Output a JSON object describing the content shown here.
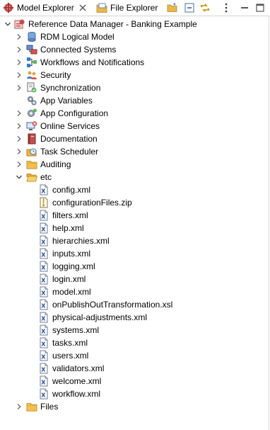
{
  "tabs": [
    {
      "label": "Model Explorer",
      "active": true,
      "icon": "model-explorer-icon"
    },
    {
      "label": "File Explorer",
      "active": false,
      "icon": "file-explorer-icon"
    }
  ],
  "toolbar": [
    "open-folder-icon",
    "collapse-all-icon",
    "link-editor-icon",
    "view-menu-icon"
  ],
  "tree": {
    "root": {
      "label": "Reference Data Manager - Banking Example",
      "expanded": true
    },
    "items": [
      {
        "label": "RDM Logical Model",
        "icon": "database-icon",
        "expanded": false
      },
      {
        "label": "Connected Systems",
        "icon": "connected-systems-icon",
        "expanded": false
      },
      {
        "label": "Workflows and Notifications",
        "icon": "workflow-icon",
        "expanded": false
      },
      {
        "label": "Security",
        "icon": "users-icon",
        "expanded": false
      },
      {
        "label": "Synchronization",
        "icon": "sync-icon",
        "expanded": false
      },
      {
        "label": "App Variables",
        "icon": "gears-icon",
        "expanded": null
      },
      {
        "label": "App Configuration",
        "icon": "gear-icon",
        "expanded": false
      },
      {
        "label": "Online Services",
        "icon": "online-services-icon",
        "expanded": false
      },
      {
        "label": "Documentation",
        "icon": "book-icon",
        "expanded": false
      },
      {
        "label": "Task Scheduler",
        "icon": "clock-icon",
        "expanded": false
      },
      {
        "label": "Auditing",
        "icon": "folder-closed-icon",
        "expanded": false
      },
      {
        "label": "etc",
        "icon": "folder-open-icon",
        "expanded": true
      }
    ],
    "files": [
      {
        "label": "config.xml",
        "icon": "xml-file-icon"
      },
      {
        "label": "configurationFiles.zip",
        "icon": "zip-file-icon"
      },
      {
        "label": "filters.xml",
        "icon": "xml-file-icon"
      },
      {
        "label": "help.xml",
        "icon": "xml-file-icon"
      },
      {
        "label": "hierarchies.xml",
        "icon": "xml-file-icon"
      },
      {
        "label": "inputs.xml",
        "icon": "xml-file-icon"
      },
      {
        "label": "logging.xml",
        "icon": "xml-file-icon"
      },
      {
        "label": "login.xml",
        "icon": "xml-file-icon"
      },
      {
        "label": "model.xml",
        "icon": "xml-file-icon"
      },
      {
        "label": "onPublishOutTransformation.xsl",
        "icon": "xml-file-icon"
      },
      {
        "label": "physical-adjustments.xml",
        "icon": "xml-file-icon"
      },
      {
        "label": "systems.xml",
        "icon": "xml-file-icon"
      },
      {
        "label": "tasks.xml",
        "icon": "xml-file-icon"
      },
      {
        "label": "users.xml",
        "icon": "xml-file-icon"
      },
      {
        "label": "validators.xml",
        "icon": "xml-file-icon"
      },
      {
        "label": "welcome.xml",
        "icon": "xml-file-icon"
      },
      {
        "label": "workflow.xml",
        "icon": "xml-file-icon"
      }
    ],
    "trailing": {
      "label": "Files",
      "icon": "folder-closed-icon",
      "expanded": false
    }
  }
}
